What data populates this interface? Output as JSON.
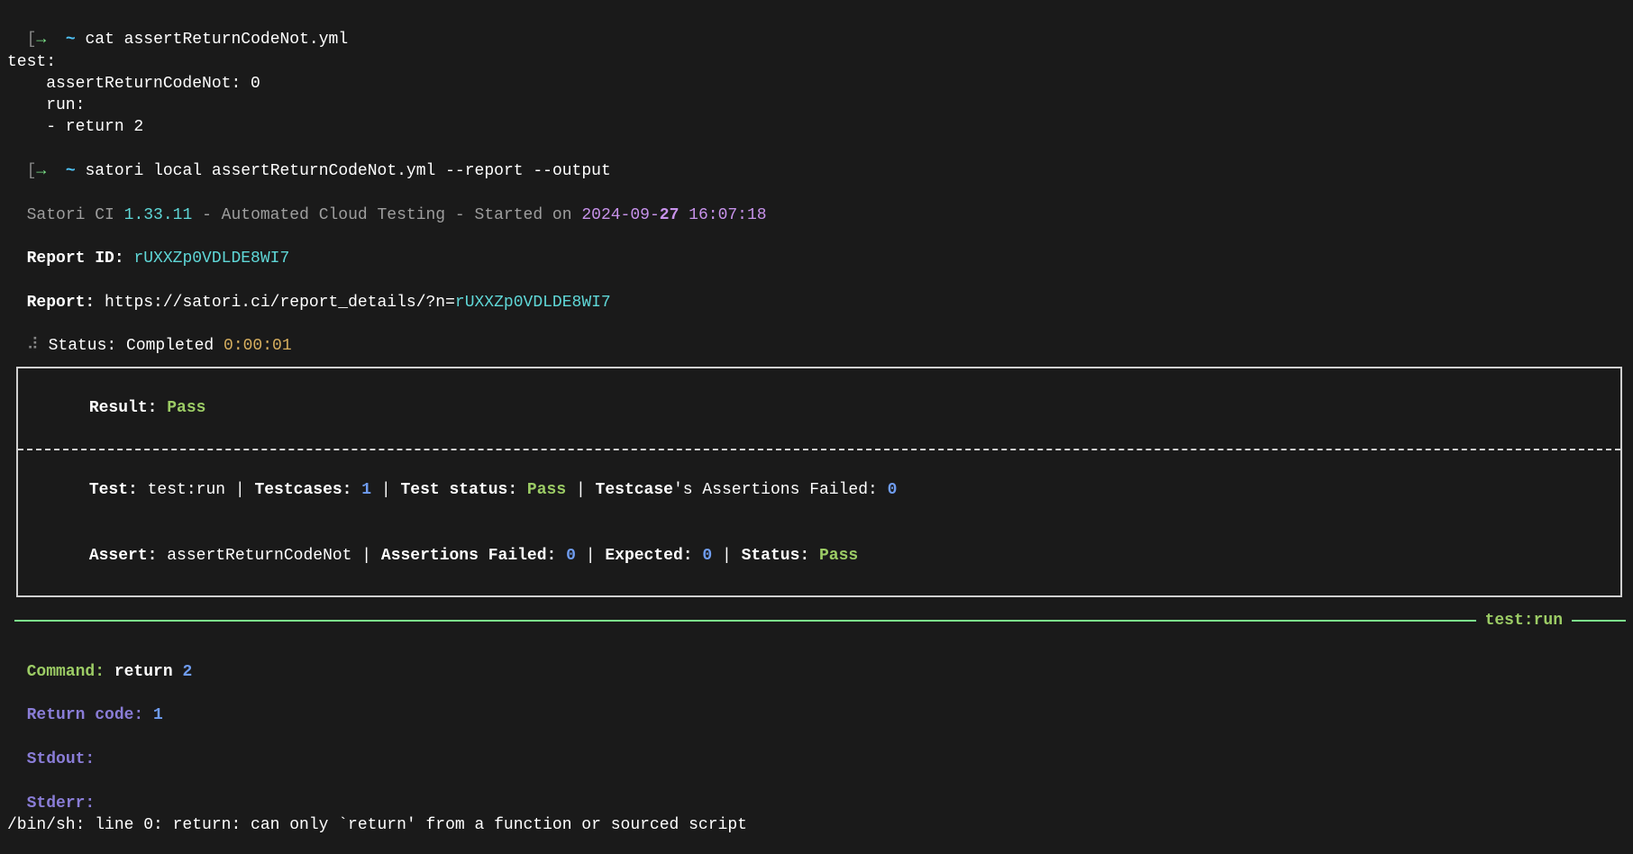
{
  "prompt1": {
    "bracket_open": "[",
    "arrow": "→",
    "tilde": "~",
    "command": "cat assertReturnCodeNot.yml"
  },
  "yml": {
    "line1": "test:",
    "line2": "    assertReturnCodeNot: 0",
    "line3": "    run:",
    "line4": "    - return 2"
  },
  "prompt2": {
    "bracket_open": "[",
    "arrow": "→",
    "tilde": "~",
    "command": "satori local assertReturnCodeNot.yml --report --output"
  },
  "banner": {
    "prefix": "Satori CI ",
    "version": "1.33.11",
    "middle": " - Automated Cloud Testing - Started on ",
    "date_prefix": "2024-09-",
    "date_day": "27",
    "time": " 16:07:18"
  },
  "report_id": {
    "label": "Report ID: ",
    "value": "rUXXZp0VDLDE8WI7"
  },
  "report_url": {
    "label": "Report:",
    "prefix": " https://satori.ci/report_details/?n=",
    "id": "rUXXZp0VDLDE8WI7"
  },
  "status_line": {
    "spinner": "⠼",
    "label": " Status: Completed ",
    "time": "0:00:01"
  },
  "result_box": {
    "result_label": "Result: ",
    "result_value": "Pass",
    "test_label": "Test:",
    "test_value": " test:run",
    "sep1": " | ",
    "testcases_label": "Testcases:",
    "testcases_value": " 1",
    "sep2": " | ",
    "teststatus_label": "Test status:",
    "teststatus_value": " Pass",
    "sep3": " | ",
    "tcaf_label": "Testcase",
    "tcaf_rest": "'s Assertions Failed:",
    "tcaf_value": " 0",
    "assert_label": "Assert:",
    "assert_value": " assertReturnCodeNot",
    "sep4": " | ",
    "af_label": "Assertions Failed:",
    "af_value": " 0",
    "sep5": " | ",
    "expected_label": "Expected:",
    "expected_value": " 0",
    "sep6": " | ",
    "status_label": "Status:",
    "status_value": " Pass"
  },
  "section_label": "test:run",
  "exec": {
    "command_label": "Command:",
    "command_value_prefix": " return ",
    "command_value_arg": "2",
    "rc_label": "Return code:",
    "rc_value": " 1",
    "stdout_label": "Stdout:",
    "stderr_label": "Stderr:",
    "stderr_text": "/bin/sh: line 0: return: can only `return' from a function or sourced script"
  }
}
